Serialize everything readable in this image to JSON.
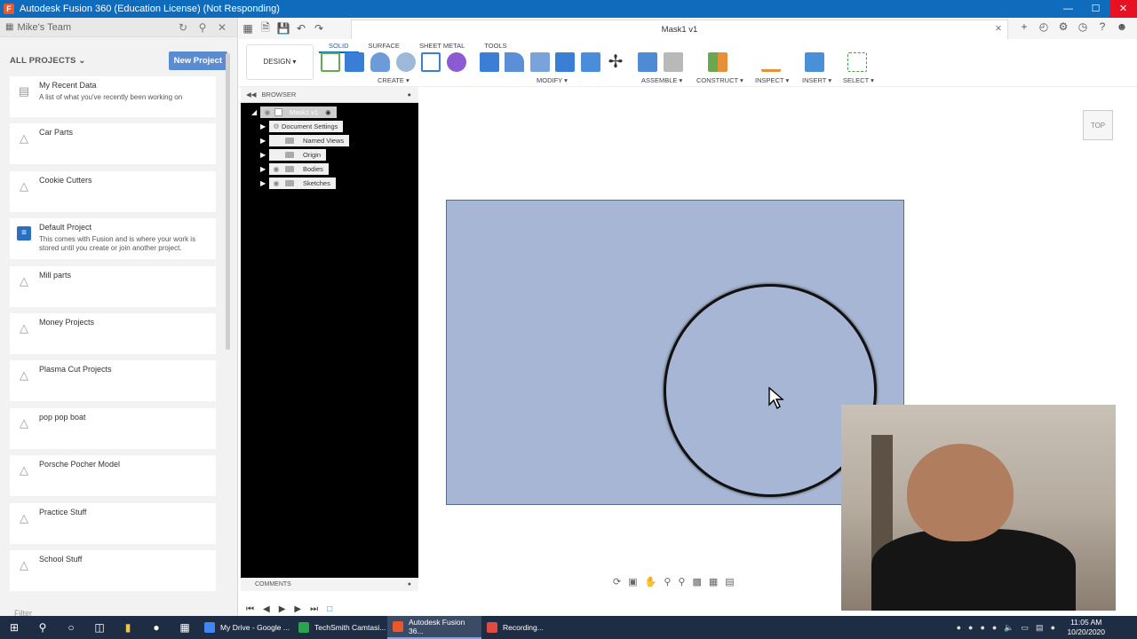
{
  "window": {
    "title": "Autodesk Fusion 360 (Education License) (Not Responding)",
    "app_icon": "F"
  },
  "datapanel": {
    "team": "Mike's Team",
    "all_projects": "ALL PROJECTS",
    "new_project": "New Project",
    "filter": "Filter",
    "projects": [
      {
        "name": "My Recent Data",
        "desc": "A list of what you've recently been working on"
      },
      {
        "name": "Car Parts",
        "desc": ""
      },
      {
        "name": "Cookie Cutters",
        "desc": ""
      },
      {
        "name": "Default Project",
        "desc": "This comes with Fusion and is where your work is stored until you create or join another project."
      },
      {
        "name": "Mill parts",
        "desc": ""
      },
      {
        "name": "Money Projects",
        "desc": ""
      },
      {
        "name": "Plasma Cut Projects",
        "desc": ""
      },
      {
        "name": "pop pop boat",
        "desc": ""
      },
      {
        "name": "Porsche Pocher Model",
        "desc": ""
      },
      {
        "name": "Practice Stuff",
        "desc": ""
      },
      {
        "name": "School Stuff",
        "desc": ""
      }
    ]
  },
  "document": {
    "tab_title": "Mask1 v1"
  },
  "toolbar": {
    "workspace": "DESIGN ▾",
    "tabs": [
      "SOLID",
      "SURFACE",
      "SHEET METAL",
      "TOOLS"
    ],
    "groups": [
      "CREATE ▾",
      "MODIFY ▾",
      "ASSEMBLE ▾",
      "CONSTRUCT ▾",
      "INSPECT ▾",
      "INSERT ▾",
      "SELECT ▾"
    ]
  },
  "browser": {
    "title": "BROWSER",
    "root": "Mask1 v1",
    "nodes": [
      "Document Settings",
      "Named Views",
      "Origin",
      "Bodies",
      "Sketches"
    ],
    "comments": "COMMENTS"
  },
  "viewcube": {
    "face": "TOP"
  },
  "taskbar": {
    "apps": [
      {
        "label": "My Drive - Google ...",
        "color": "#4285f4",
        "active": false
      },
      {
        "label": "TechSmith Camtasi...",
        "color": "#2aa44f",
        "active": false
      },
      {
        "label": "Autodesk Fusion 36...",
        "color": "#e8582a",
        "active": true
      },
      {
        "label": "Recording...",
        "color": "#e04a3f",
        "active": false
      }
    ],
    "time": "11:05 AM",
    "date": "10/20/2020"
  }
}
